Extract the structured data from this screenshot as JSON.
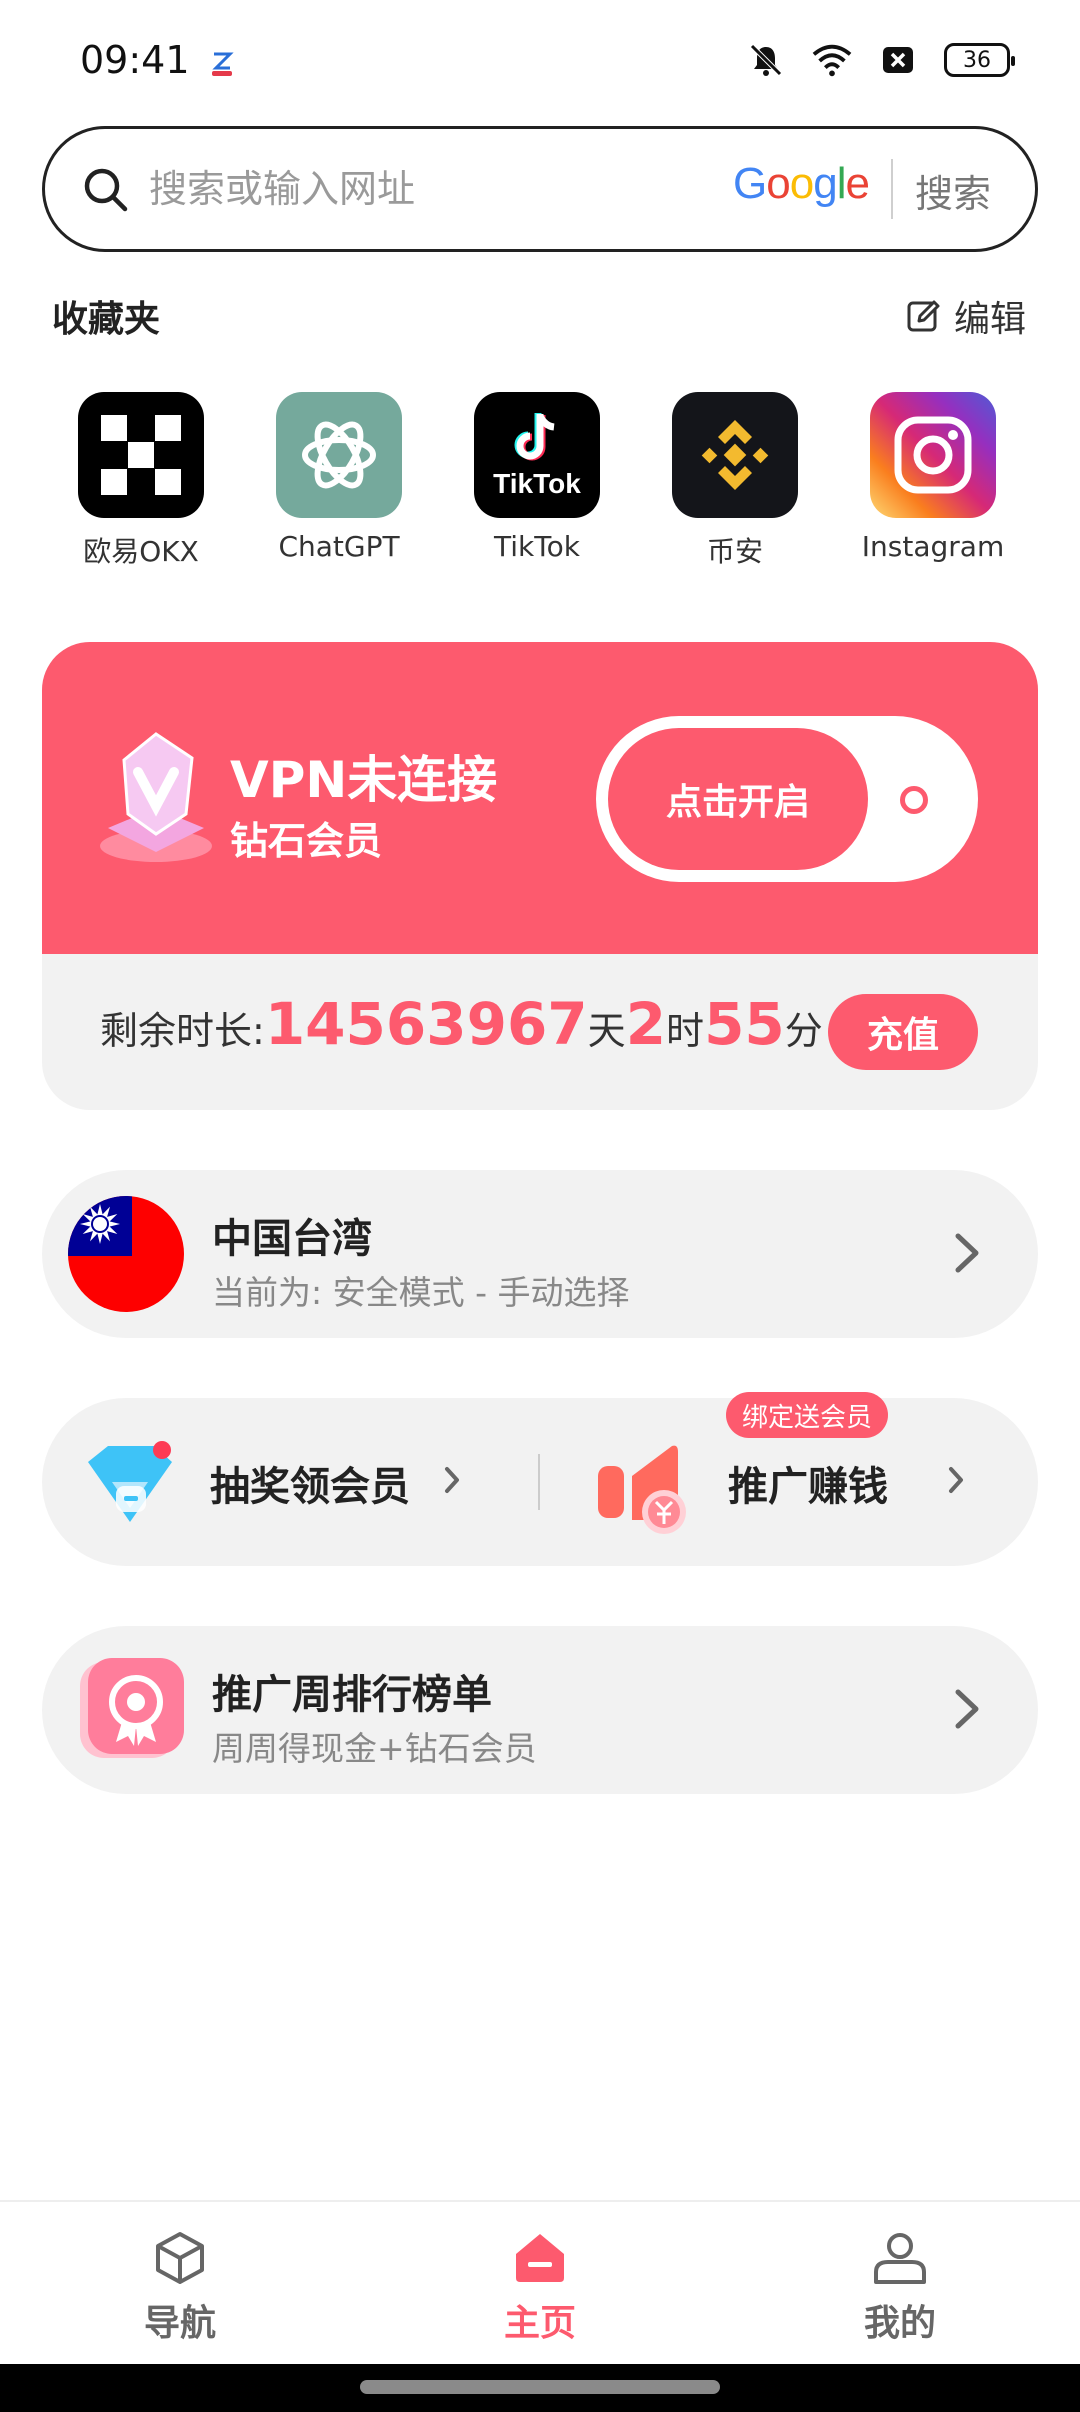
{
  "status_bar": {
    "time": "09:41",
    "battery": "36",
    "icons": [
      "app-notification-icon",
      "mute-icon",
      "wifi-icon",
      "sim-off-icon",
      "battery-icon"
    ]
  },
  "search": {
    "placeholder": "搜索或输入网址",
    "engine": "Google",
    "button": "搜索"
  },
  "favorites": {
    "title": "收藏夹",
    "edit_label": "编辑",
    "apps": [
      {
        "label": "欧易OKX",
        "icon": "okx-icon"
      },
      {
        "label": "ChatGPT",
        "icon": "chatgpt-icon"
      },
      {
        "label": "TikTok",
        "icon": "tiktok-icon",
        "icon_text": "TikTok"
      },
      {
        "label": "币安",
        "icon": "binance-icon"
      },
      {
        "label": "Instagram",
        "icon": "instagram-icon"
      }
    ]
  },
  "vpn": {
    "status": "VPN未连接",
    "member": "钻石会员",
    "toggle_label": "点击开启",
    "remaining_label": "剩余时长:",
    "days": "14563967",
    "days_unit": "天",
    "hours": "2",
    "hours_unit": "时",
    "minutes": "55",
    "minutes_unit": "分",
    "recharge": "充值",
    "colors": {
      "accent": "#fd5a6e",
      "card_bg": "#f2f2f2"
    }
  },
  "region": {
    "title": "中国台湾",
    "subtitle": "当前为: 安全模式 - 手动选择"
  },
  "promo": {
    "lottery_label": "抽奖领会员",
    "earn_label": "推广赚钱",
    "bind_badge": "绑定送会员"
  },
  "ranking": {
    "title": "推广周排行榜单",
    "subtitle": "周周得现金+钻石会员"
  },
  "bottom_nav": {
    "items": [
      {
        "label": "导航",
        "icon": "cube-icon"
      },
      {
        "label": "主页",
        "icon": "home-icon",
        "active": true
      },
      {
        "label": "我的",
        "icon": "user-icon"
      }
    ]
  }
}
